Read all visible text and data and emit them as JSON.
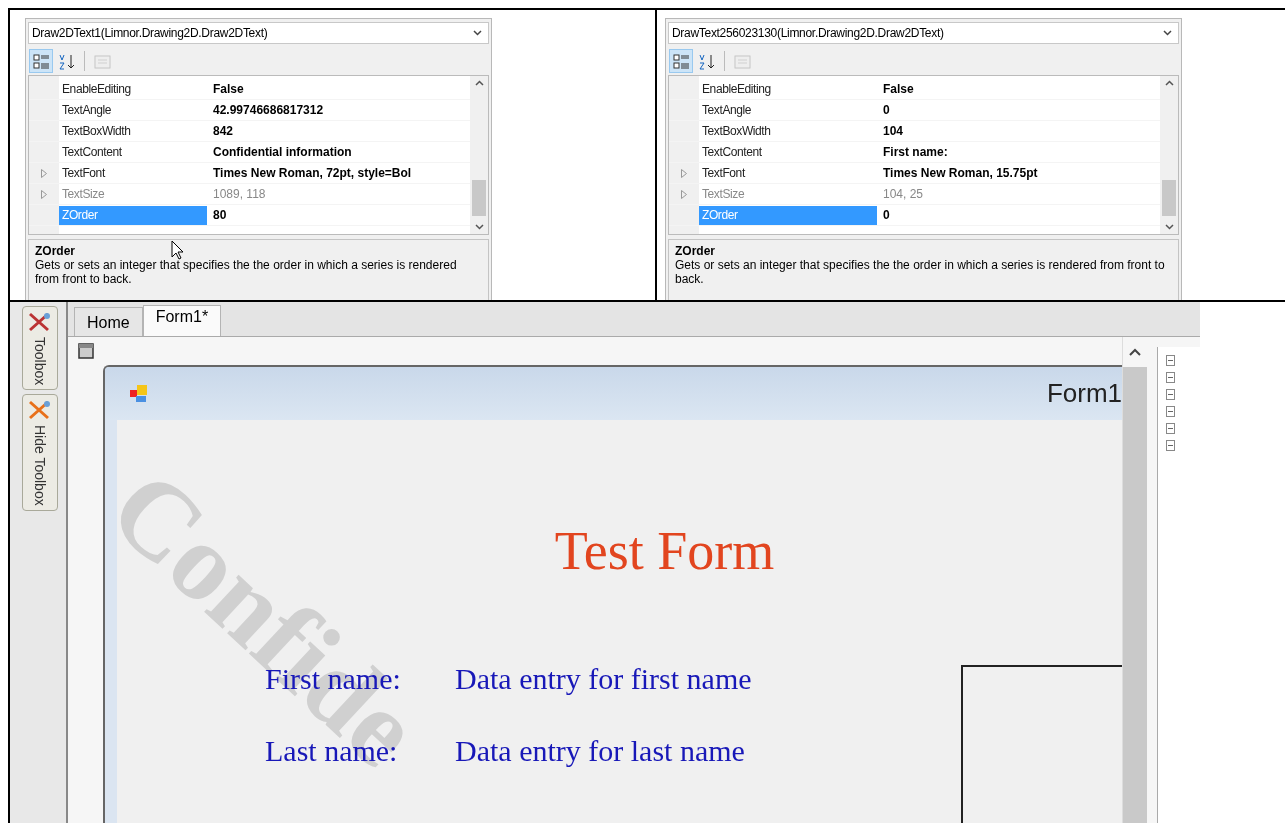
{
  "property_panels": [
    {
      "object_selector": "Draw2DText1(Limnor.Drawing2D.Draw2DText)",
      "toolbar": [
        {
          "kind": "categorized",
          "selected": true,
          "disabled": false
        },
        {
          "kind": "alphabetical",
          "selected": false,
          "disabled": false
        },
        {
          "kind": "property-pages",
          "selected": false,
          "disabled": true
        }
      ],
      "properties": [
        {
          "name": "EnableEditing",
          "value": "False",
          "expandable": false,
          "disabled": false,
          "selected": false
        },
        {
          "name": "TextAngle",
          "value": "42.99746686817312",
          "expandable": false,
          "disabled": false,
          "selected": false
        },
        {
          "name": "TextBoxWidth",
          "value": "842",
          "expandable": false,
          "disabled": false,
          "selected": false
        },
        {
          "name": "TextContent",
          "value": "Confidential information",
          "expandable": false,
          "disabled": false,
          "selected": false
        },
        {
          "name": "TextFont",
          "value": "Times New Roman, 72pt, style=Bol",
          "expandable": true,
          "disabled": false,
          "selected": false
        },
        {
          "name": "TextSize",
          "value": "1089, 118",
          "expandable": true,
          "disabled": true,
          "selected": false
        },
        {
          "name": "ZOrder",
          "value": "80",
          "expandable": false,
          "disabled": false,
          "selected": true
        }
      ],
      "description_title": "ZOrder",
      "description": "Gets or sets an integer that specifies the the order in which a series is rendered from front to back."
    },
    {
      "object_selector": "DrawText256023130(Limnor.Drawing2D.Draw2DText)",
      "toolbar": [
        {
          "kind": "categorized",
          "selected": true,
          "disabled": false
        },
        {
          "kind": "alphabetical",
          "selected": false,
          "disabled": false
        },
        {
          "kind": "property-pages",
          "selected": false,
          "disabled": true
        }
      ],
      "properties": [
        {
          "name": "EnableEditing",
          "value": "False",
          "expandable": false,
          "disabled": false,
          "selected": false
        },
        {
          "name": "TextAngle",
          "value": "0",
          "expandable": false,
          "disabled": false,
          "selected": false
        },
        {
          "name": "TextBoxWidth",
          "value": "104",
          "expandable": false,
          "disabled": false,
          "selected": false
        },
        {
          "name": "TextContent",
          "value": "First name:",
          "expandable": false,
          "disabled": false,
          "selected": false
        },
        {
          "name": "TextFont",
          "value": "Times New Roman, 15.75pt",
          "expandable": true,
          "disabled": false,
          "selected": false
        },
        {
          "name": "TextSize",
          "value": "104, 25",
          "expandable": true,
          "disabled": true,
          "selected": false
        },
        {
          "name": "ZOrder",
          "value": "0",
          "expandable": false,
          "disabled": false,
          "selected": true
        }
      ],
      "description_title": "ZOrder",
      "description": "Gets or sets an integer that specifies the the order in which a series is rendered from front to back."
    }
  ],
  "designer": {
    "side_tabs": [
      {
        "label": "Toolbox"
      },
      {
        "label": "Hide Toolbox"
      }
    ],
    "tabs": [
      {
        "label": "Home",
        "selected": false
      },
      {
        "label": "Form1*",
        "selected": true
      }
    ],
    "form": {
      "title": "Form1",
      "watermark": "Confide",
      "heading": "Test Form",
      "fields": [
        {
          "label": "First name:",
          "value": "Data entry for first name"
        },
        {
          "label": "Last name:",
          "value": "Data entry for last name"
        }
      ]
    }
  }
}
